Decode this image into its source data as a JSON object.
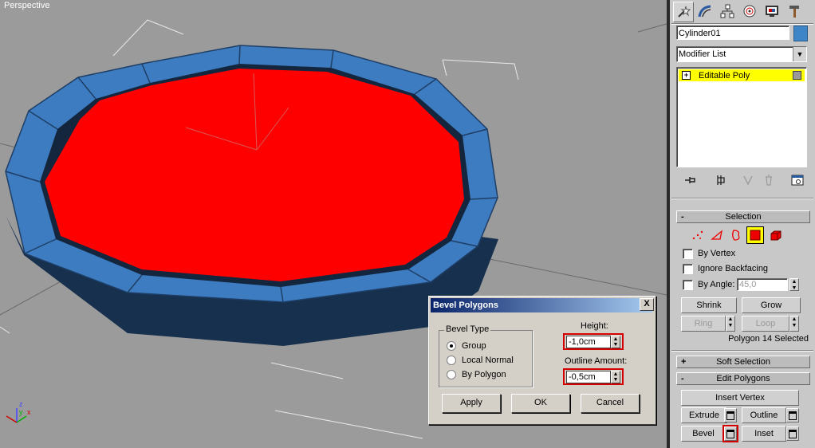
{
  "viewport": {
    "label": "Perspective",
    "axis_labels": {
      "z": "z",
      "y": "y",
      "x": "x"
    }
  },
  "command_panel": {
    "tab_icons": [
      "create-icon",
      "modify-icon",
      "hierarchy-icon",
      "motion-icon",
      "display-icon",
      "utilities-icon"
    ],
    "object_name": "Cylinder01",
    "object_color": "#3d85c6",
    "modifier_list": "Modifier List",
    "stack": {
      "item": "Editable Poly",
      "expand_sign": "+"
    },
    "stack_tools": [
      "pin-stack-icon",
      "show-end-result-icon",
      "make-unique-icon",
      "remove-modifier-icon",
      "configure-modifier-sets-icon"
    ]
  },
  "selection": {
    "title": "Selection",
    "sign": "-",
    "levels": [
      "vertex-icon",
      "edge-icon",
      "border-icon",
      "polygon-icon",
      "element-icon"
    ],
    "active_level": "polygon-icon",
    "by_vertex": "By Vertex",
    "ignore_backfacing": "Ignore Backfacing",
    "by_angle": "By Angle:",
    "by_angle_value": "45,0",
    "shrink": "Shrink",
    "grow": "Grow",
    "ring": "Ring",
    "loop": "Loop",
    "status": "Polygon 14 Selected"
  },
  "soft_selection": {
    "title": "Soft Selection",
    "sign": "+"
  },
  "edit_polygons": {
    "title": "Edit Polygons",
    "sign": "-",
    "insert_vertex": "Insert Vertex",
    "extrude": "Extrude",
    "outline": "Outline",
    "bevel": "Bevel",
    "inset": "Inset"
  },
  "dialog": {
    "title": "Bevel Polygons",
    "close": "X",
    "bevel_type": "Bevel Type",
    "group": "Group",
    "local_normal": "Local Normal",
    "by_polygon": "By Polygon",
    "selected_type": "Group",
    "height_label": "Height:",
    "height_value": "-1,0cm",
    "outline_label": "Outline Amount:",
    "outline_value": "-0,5cm",
    "apply": "Apply",
    "ok": "OK",
    "cancel": "Cancel"
  },
  "colors": {
    "polygon_selected": "#ff0000",
    "rim_face": "#3d7cc0",
    "rim_side": "#16304e",
    "highlight": "#ffff00",
    "callout": "#d40000"
  }
}
